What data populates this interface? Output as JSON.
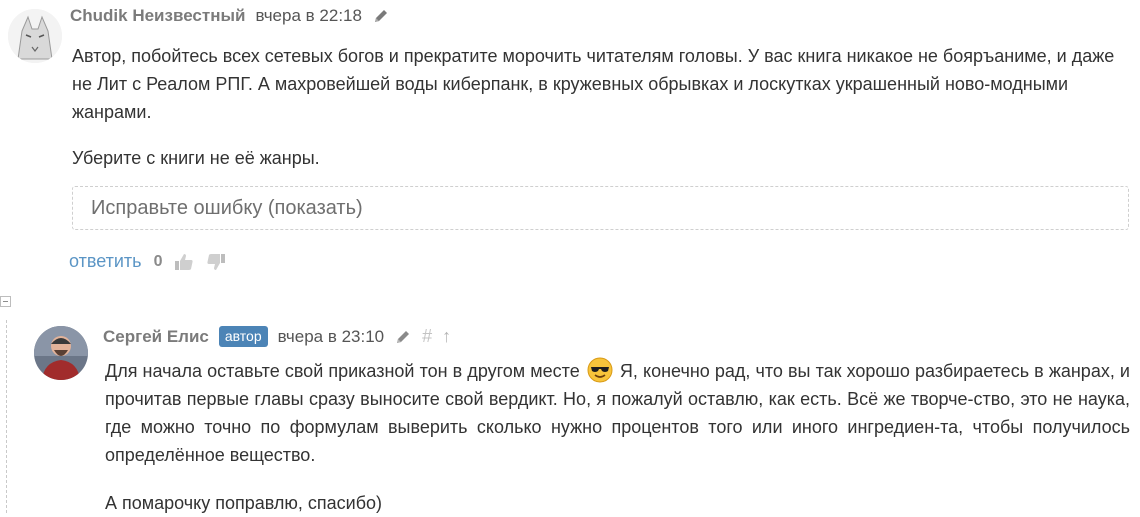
{
  "comments": [
    {
      "author": "Chudik Неизвестный",
      "time": "вчера в 22:18",
      "paragraphs": [
        "Автор, побойтесь всех сетевых богов и прекратите морочить читателям головы. У вас книга никакое не бояръаниме, и даже не Лит с Реалом РПГ. А махровейшей воды киберпанк, в кружевных обрывках и лоскутках украшенный ново-модными жанрами.",
        "Уберите с книги не её жанры."
      ],
      "fix_label": "Исправьте ошибку (показать)",
      "reply_label": "ответить",
      "score": "0"
    },
    {
      "author": "Сергей Елис",
      "badge": "автор",
      "time": "вчера в 23:10",
      "hash": "#",
      "up": "↑",
      "p1_before": "Для начала оставьте свой приказной тон в другом месте",
      "p1_after": "Я, конечно рад, что вы так хорошо разбираетесь в жанрах, и прочитав первые главы сразу выносите свой вердикт. Но, я пожалуй оставлю, как есть. Всё же творче-ство, это не наука, где можно точно по формулам выверить сколько нужно процентов того или иного ингредиен-та, чтобы получилось определённое вещество.",
      "p2": "А помарочку поправлю, спасибо)"
    }
  ],
  "icons": {
    "edit": "pencil-icon",
    "like": "thumbs-up-icon",
    "dislike": "thumbs-down-icon",
    "emoji": "sunglasses-emoji-icon",
    "collapse": "collapse-minus-icon"
  },
  "colors": {
    "author": "#7b7b7b",
    "badge_bg": "#4c84b6",
    "reply_link": "#5b95c5"
  }
}
